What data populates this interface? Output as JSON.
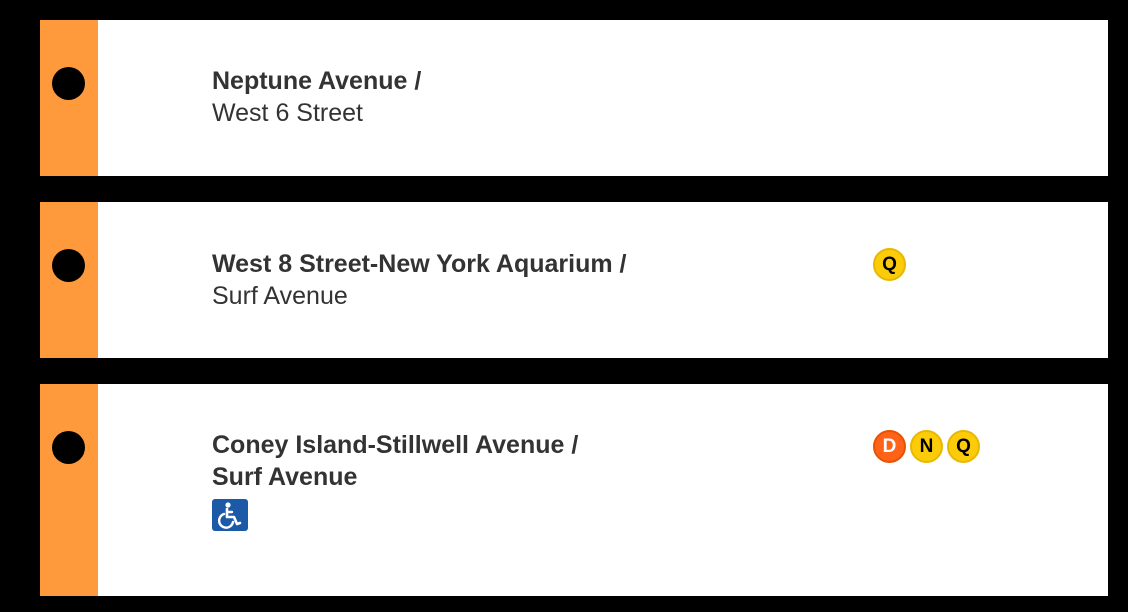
{
  "colors": {
    "line_bar": "#ff9a3c",
    "background": "#000000",
    "row_bg": "#ffffff",
    "text": "#333333",
    "bullet_yellow": "#fccc0a",
    "bullet_orange": "#ff6319",
    "accessible_badge": "#1c5aa8"
  },
  "stations": [
    {
      "name_line1": "Neptune Avenue /",
      "name_line2": "West 6 Street",
      "line2_bold": false,
      "routes": [],
      "accessible": false
    },
    {
      "name_line1": "West 8 Street-New York Aquarium /",
      "name_line2": "Surf Avenue",
      "line2_bold": false,
      "routes": [
        {
          "letter": "Q",
          "color": "yellow"
        }
      ],
      "accessible": false
    },
    {
      "name_line1": "Coney Island-Stillwell Avenue /",
      "name_line2": "Surf Avenue",
      "line2_bold": true,
      "routes": [
        {
          "letter": "D",
          "color": "orange"
        },
        {
          "letter": "N",
          "color": "yellow"
        },
        {
          "letter": "Q",
          "color": "yellow"
        }
      ],
      "accessible": true,
      "accessible_icon": "wheelchair-icon"
    }
  ]
}
